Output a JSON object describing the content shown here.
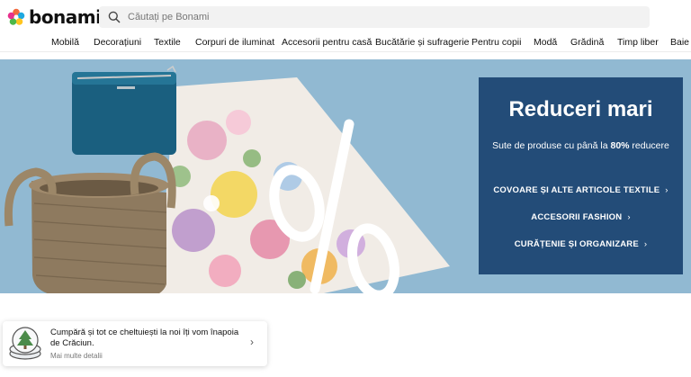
{
  "header": {
    "logo_text": "bonami",
    "search_placeholder": "Căutați pe Bonami",
    "icons": [
      "bonami-logo-icon",
      "search-icon"
    ]
  },
  "nav": {
    "items": [
      {
        "label": "Mobilă"
      },
      {
        "label": "Decorațiuni"
      },
      {
        "label": "Textile"
      },
      {
        "label": "Corpuri de iluminat"
      },
      {
        "label": "Accesorii pentru casă"
      },
      {
        "label": "Bucătărie și sufragerie"
      },
      {
        "label": "Pentru copii"
      },
      {
        "label": "Modă"
      },
      {
        "label": "Grădină"
      },
      {
        "label": "Timp liber"
      },
      {
        "label": "Baie"
      }
    ]
  },
  "hero": {
    "percent_sign": "%",
    "promo": {
      "title": "Reduceri mari",
      "subtitle_prefix": "Sute de produse cu până la ",
      "subtitle_bold": "80%",
      "subtitle_suffix": " reducere",
      "links": [
        {
          "label": "COVOARE ȘI ALTE ARTICOLE TEXTILE",
          "chevron": "›"
        },
        {
          "label": "ACCESORII FASHION",
          "chevron": "›"
        },
        {
          "label": "CURĂȚENIE ȘI ORGANIZARE",
          "chevron": "›"
        }
      ]
    },
    "colors": {
      "background": "#91b9d2",
      "promo_box": "#234c78"
    }
  },
  "notice": {
    "text": "Cumpără și tot ce cheltuiești la noi îți vom înapoia de Crăciun.",
    "more": "Mai multe detalii",
    "chevron": "›",
    "icon": "christmas-tree-coins-icon"
  }
}
